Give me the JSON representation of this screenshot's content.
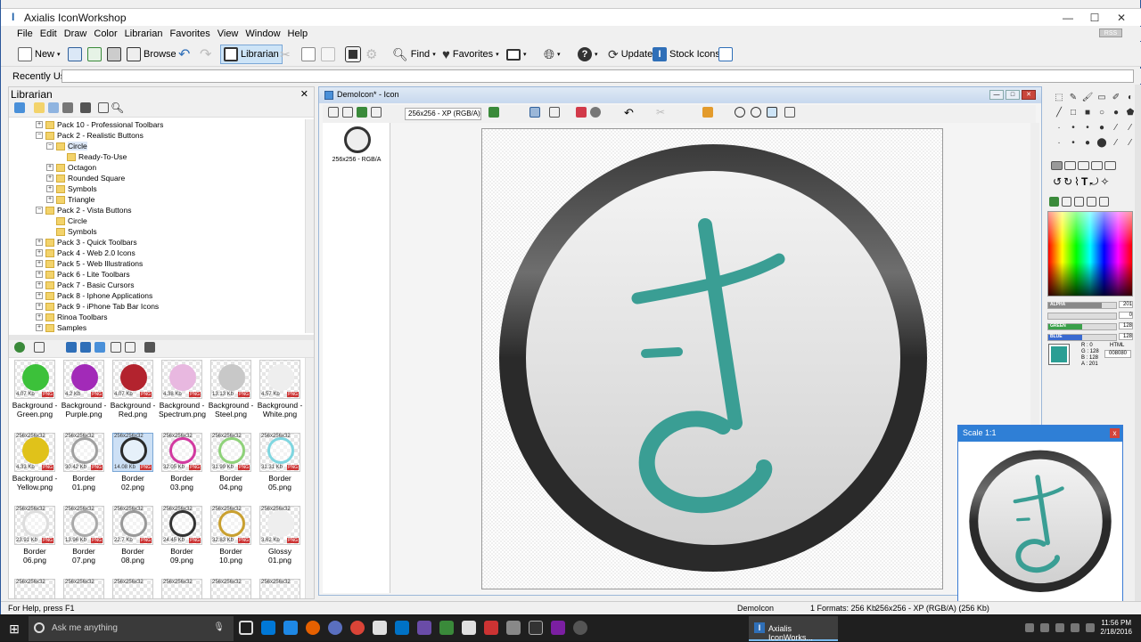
{
  "app": {
    "title": "Axialis IconWorkshop",
    "menu": [
      "File",
      "Edit",
      "Draw",
      "Color",
      "Librarian",
      "Favorites",
      "View",
      "Window",
      "Help"
    ],
    "rss": "RSS"
  },
  "toolbar": {
    "new": "New",
    "browse": "Browse",
    "librarian": "Librarian",
    "find": "Find",
    "favorites": "Favorites",
    "update": "Update",
    "stock_icons": "Stock Icons"
  },
  "recent": {
    "label": "Recently Used"
  },
  "librarian": {
    "title": "Librarian",
    "tree": [
      {
        "label": "Pack 10 - Professional Toolbars",
        "level": 1,
        "exp": "+"
      },
      {
        "label": "Pack 2 - Realistic Buttons",
        "level": 1,
        "exp": "−"
      },
      {
        "label": "Circle",
        "level": 2,
        "exp": "−",
        "selected": true
      },
      {
        "label": "Ready-To-Use",
        "level": 3,
        "exp": ""
      },
      {
        "label": "Octagon",
        "level": 2,
        "exp": "+"
      },
      {
        "label": "Rounded Square",
        "level": 2,
        "exp": "+"
      },
      {
        "label": "Symbols",
        "level": 2,
        "exp": "+"
      },
      {
        "label": "Triangle",
        "level": 2,
        "exp": "+"
      },
      {
        "label": "Pack 2 - Vista Buttons",
        "level": 1,
        "exp": "−"
      },
      {
        "label": "Circle",
        "level": 2,
        "exp": ""
      },
      {
        "label": "Symbols",
        "level": 2,
        "exp": ""
      },
      {
        "label": "Pack 3 - Quick Toolbars",
        "level": 1,
        "exp": "+"
      },
      {
        "label": "Pack 4 - Web 2.0 Icons",
        "level": 1,
        "exp": "+"
      },
      {
        "label": "Pack 5 - Web Illustrations",
        "level": 1,
        "exp": "+"
      },
      {
        "label": "Pack 6 - Lite Toolbars",
        "level": 1,
        "exp": "+"
      },
      {
        "label": "Pack 7 - Basic Cursors",
        "level": 1,
        "exp": "+"
      },
      {
        "label": "Pack 8 - Iphone Applications",
        "level": 1,
        "exp": "+"
      },
      {
        "label": "Pack 9 - iPhone Tab Bar Icons",
        "level": 1,
        "exp": "+"
      },
      {
        "label": "Rinoa Toolbars",
        "level": 1,
        "exp": "+"
      },
      {
        "label": "Samples",
        "level": 1,
        "exp": "+"
      }
    ],
    "gallery": [
      {
        "name": "Background - Green.png",
        "size": "4.07 Kb",
        "dim": "",
        "color": "#3cc13a",
        "ring": false
      },
      {
        "name": "Background - Purple.png",
        "size": "4.2 Kb",
        "dim": "",
        "color": "#a22ab8",
        "ring": false
      },
      {
        "name": "Background - Red.png",
        "size": "4.07 Kb",
        "dim": "",
        "color": "#b3232e",
        "ring": false
      },
      {
        "name": "Background - Spectrum.png",
        "size": "4.38 Kb",
        "dim": "",
        "color": "#e8b8e0",
        "ring": false
      },
      {
        "name": "Background - Steel.png",
        "size": "13.13 Kb",
        "dim": "",
        "color": "#c8c8c8",
        "ring": false
      },
      {
        "name": "Background - White.png",
        "size": "4.57 Kb",
        "dim": "",
        "color": "#eeeeee",
        "ring": false
      },
      {
        "name": "Background - Yellow.png",
        "size": "4.33 Kb",
        "dim": "256x256x32",
        "color": "#e0c21a",
        "ring": false
      },
      {
        "name": "Border 01.png",
        "size": "30.42 Kb",
        "dim": "256x256x32",
        "color": "#a0a0a0",
        "ring": true
      },
      {
        "name": "Border 02.png",
        "size": "14.08 Kb",
        "dim": "256x256x32",
        "color": "#2a2a2a",
        "ring": true
      },
      {
        "name": "Border 03.png",
        "size": "32.05 Kb",
        "dim": "256x256x32",
        "color": "#d23aa0",
        "ring": true
      },
      {
        "name": "Border 04.png",
        "size": "31.99 Kb",
        "dim": "256x256x32",
        "color": "#8fd27a",
        "ring": true
      },
      {
        "name": "Border 05.png",
        "size": "31.31 Kb",
        "dim": "256x256x32",
        "color": "#7fd6e0",
        "ring": true
      },
      {
        "name": "Border 06.png",
        "size": "23.91 Kb",
        "dim": "256x256x32",
        "color": "#dddddd",
        "ring": true
      },
      {
        "name": "Border 07.png",
        "size": "13.96 Kb",
        "dim": "256x256x32",
        "color": "#aaaaaa",
        "ring": true
      },
      {
        "name": "Border 08.png",
        "size": "22.7 Kb",
        "dim": "256x256x32",
        "color": "#999999",
        "ring": true
      },
      {
        "name": "Border 09.png",
        "size": "24.45 Kb",
        "dim": "256x256x32",
        "color": "#333333",
        "ring": true
      },
      {
        "name": "Border 10.png",
        "size": "32.83 Kb",
        "dim": "256x256x32",
        "color": "#c9a030",
        "ring": true
      },
      {
        "name": "Glossy 01.png",
        "size": "3.62 Kb",
        "dim": "256x256x32",
        "color": "#eeeeee",
        "ring": false
      }
    ],
    "gallery_partial_dim": "256x256x32"
  },
  "document": {
    "title": "DemoIcon* - Icon",
    "format": "256x256 - XP (RGB/A)",
    "thumb_label": "256x256 - RGB/A"
  },
  "palette": {
    "alpha": {
      "label": "ALPHA",
      "value": "201",
      "fill": 0.79,
      "color": "#888888"
    },
    "red": {
      "label": "",
      "value": "0",
      "fill": 0,
      "color": "#d23a4a"
    },
    "green": {
      "label": "GREEN",
      "value": "128",
      "fill": 0.5,
      "color": "#3aa04a"
    },
    "blue": {
      "label": "BLUE",
      "value": "128",
      "fill": 0.5,
      "color": "#3a6ad0"
    },
    "rgba_text": [
      "R : 0",
      "G : 128",
      "B : 128",
      "A : 201"
    ],
    "html_label": "HTML",
    "html_value": "008080",
    "current_color": "#2b9e94"
  },
  "scale_window": {
    "title": "Scale 1:1"
  },
  "status": {
    "help": "For Help, press F1",
    "doc": "DemoIcon",
    "formats": "1 Formats: 256 Kb",
    "format_info": "256x256 - XP (RGB/A) (256 Kb)"
  },
  "taskbar": {
    "search": "Ask me anything",
    "active": "Axialis IconWorks...",
    "time": "11:56 PM",
    "date": "2/18/2016"
  }
}
